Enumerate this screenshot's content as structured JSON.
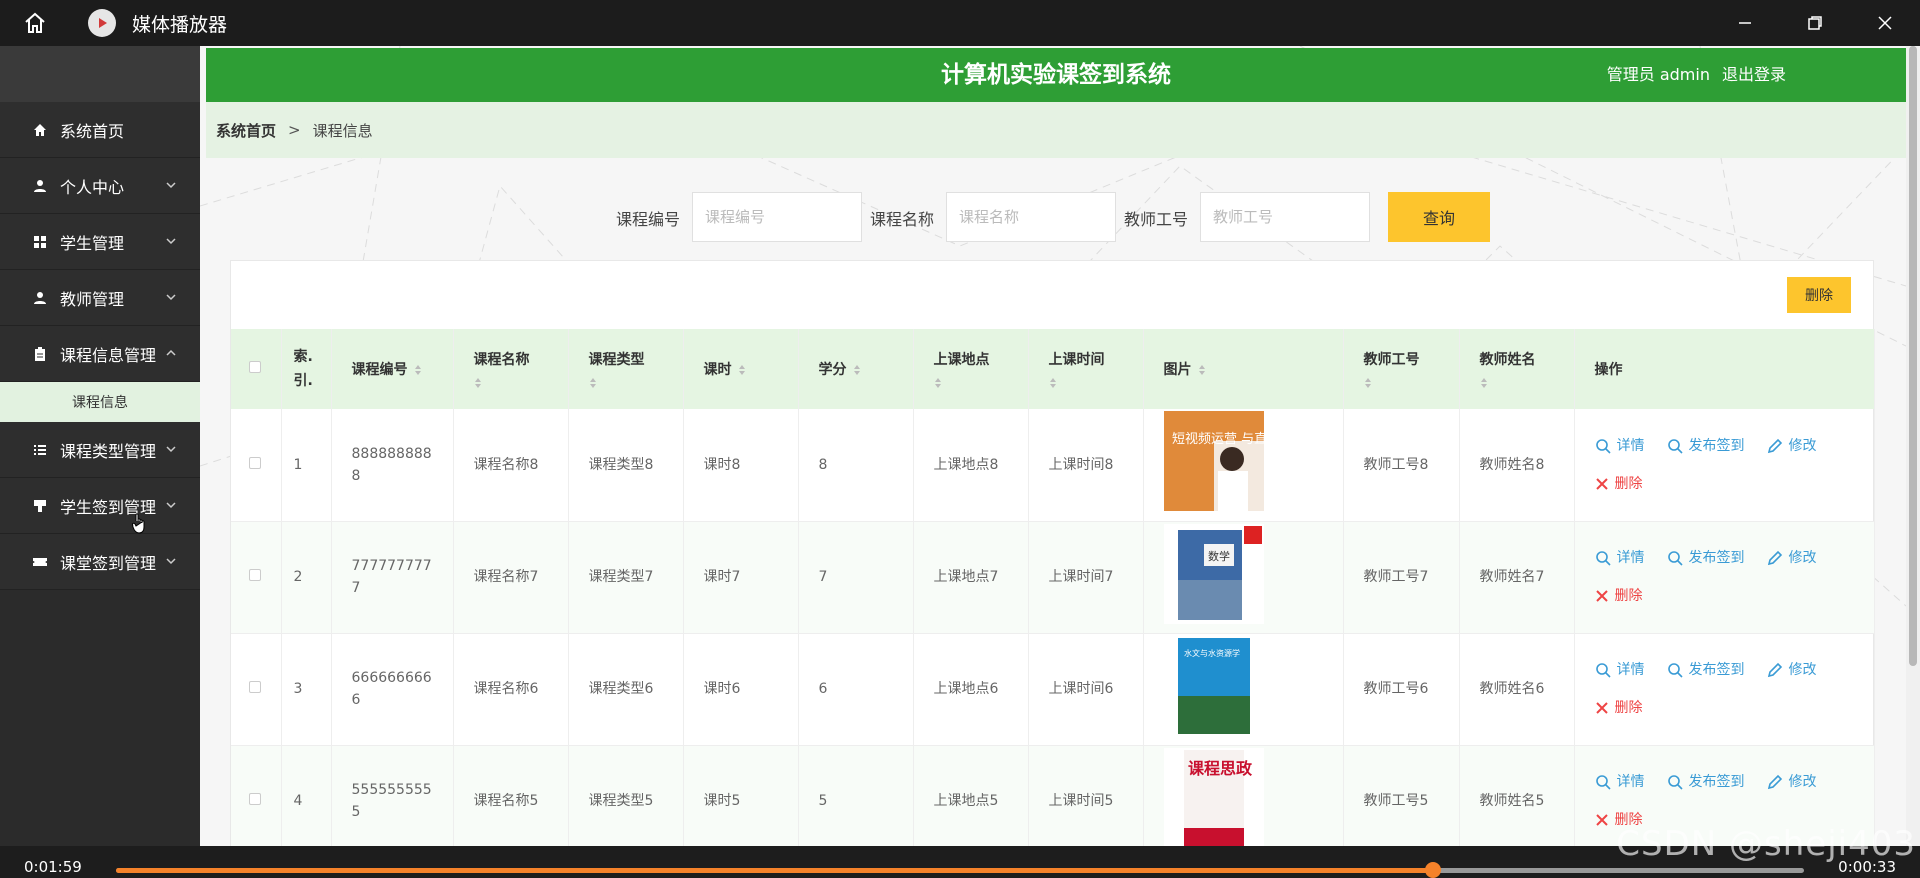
{
  "window": {
    "title": "媒体播放器"
  },
  "header": {
    "title": "计算机实验课签到系统",
    "user_label": "管理员 admin",
    "logout_label": "退出登录"
  },
  "sidebar": {
    "items": [
      {
        "label": "系统首页",
        "icon": "home-icon"
      },
      {
        "label": "个人中心",
        "icon": "user-icon"
      },
      {
        "label": "学生管理",
        "icon": "grid-icon"
      },
      {
        "label": "教师管理",
        "icon": "user-icon"
      },
      {
        "label": "课程信息管理",
        "icon": "clipboard-icon"
      },
      {
        "label": "课程类型管理",
        "icon": "list-icon"
      },
      {
        "label": "学生签到管理",
        "icon": "stamp-icon"
      },
      {
        "label": "课堂签到管理",
        "icon": "ticket-icon"
      }
    ],
    "submenu_label": "课程信息"
  },
  "breadcrumb": {
    "home": "系统首页",
    "separator": ">",
    "current": "课程信息"
  },
  "filter": {
    "code_label": "课程编号",
    "code_placeholder": "课程编号",
    "name_label": "课程名称",
    "name_placeholder": "课程名称",
    "teacher_label": "教师工号",
    "teacher_placeholder": "教师工号",
    "search_label": "查询"
  },
  "toolbar": {
    "delete_label": "删除"
  },
  "table": {
    "columns": [
      "索引",
      "课程编号",
      "课程名称",
      "课程类型",
      "课时",
      "学分",
      "上课地点",
      "上课时间",
      "图片",
      "教师工号",
      "教师姓名",
      "操作"
    ],
    "index_header_line1": "索.",
    "index_header_line2": "引.",
    "rows": [
      {
        "index": "1",
        "code": "888888888 8",
        "name": "课程名称8",
        "type": "课程类型8",
        "hours": "课时8",
        "credit": "8",
        "place": "上课地点8",
        "time": "上课时间8",
        "teacher_id": "教师工号8",
        "teacher_name": "教师姓名8",
        "cover_text": "短视频运营 与直播变现"
      },
      {
        "index": "2",
        "code": "777777777 7",
        "name": "课程名称7",
        "type": "课程类型7",
        "hours": "课时7",
        "credit": "7",
        "place": "上课地点7",
        "time": "上课时间7",
        "teacher_id": "教师工号7",
        "teacher_name": "教师姓名7",
        "cover_text": "数学"
      },
      {
        "index": "3",
        "code": "666666666 6",
        "name": "课程名称6",
        "type": "课程类型6",
        "hours": "课时6",
        "credit": "6",
        "place": "上课地点6",
        "time": "上课时间6",
        "teacher_id": "教师工号6",
        "teacher_name": "教师姓名6",
        "cover_text": "水文与水资源学"
      },
      {
        "index": "4",
        "code": "555555555 5",
        "name": "课程名称5",
        "type": "课程类型5",
        "hours": "课时5",
        "credit": "5",
        "place": "上课地点5",
        "time": "上课时间5",
        "teacher_id": "教师工号5",
        "teacher_name": "教师姓名5",
        "cover_text": "课程思政"
      }
    ],
    "actions": {
      "detail": "详情",
      "publish": "发布签到",
      "edit": "修改",
      "delete": "删除"
    }
  },
  "player": {
    "elapsed": "0:01:59",
    "remaining": "0:00:33",
    "progress_percent": 78
  },
  "watermark": "CSDN @sheji403",
  "colors": {
    "primary_green": "#2e9e35",
    "accent_yellow": "#fdc52d",
    "link_blue": "#3a9bd5",
    "danger_red": "#e44444",
    "player_orange": "#f5822a"
  }
}
